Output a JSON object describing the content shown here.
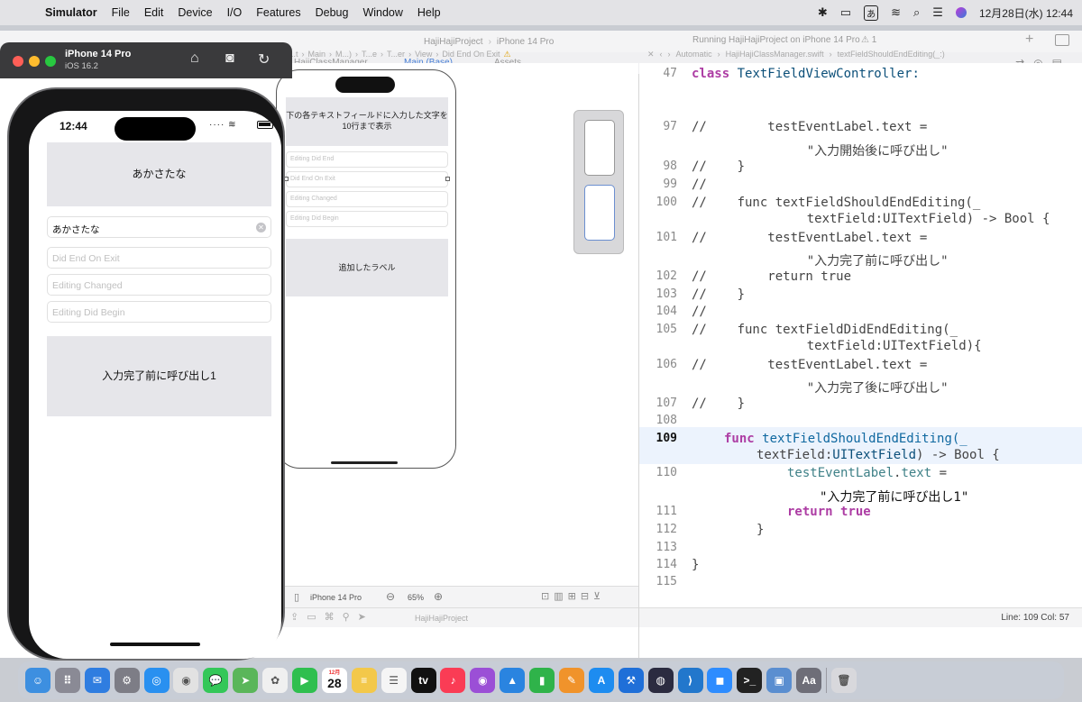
{
  "menubar": {
    "app": "Simulator",
    "items": [
      "File",
      "Edit",
      "Device",
      "I/O",
      "Features",
      "Debug",
      "Window",
      "Help"
    ],
    "input_method": "あ",
    "clock": "12月28日(水) 12:44"
  },
  "xcode": {
    "project": "HajiHajiProject",
    "scheme_device": "iPhone 14 Pro",
    "status": "Running HajiHajiProject on iPhone 14 Pro",
    "warnings": "1",
    "tabs": [
      "HajiClassManager",
      "Main (Base)",
      "Assets"
    ],
    "left_jumpbar": [
      "H...t",
      "Main",
      "M...)",
      "T...e",
      "T...er",
      "View",
      "Did End On Exit"
    ],
    "right_jumpbar": [
      "Automatic",
      "HajiHajiClassManager.swift",
      "textFieldShouldEndEditing(_:)"
    ],
    "ib": {
      "header_text": "下の各テキストフィールドに入力した文字を10行まで表示",
      "fields": [
        "Editing Did End",
        "Did End On Exit",
        "Editing Changed",
        "Editing Did Begin"
      ],
      "added_label": "追加したラベル",
      "device": "iPhone 14 Pro",
      "zoom": "65%"
    },
    "code": {
      "lines": [
        {
          "n": "47",
          "t": "class TextFieldViewController:"
        },
        {
          "n": "97",
          "t": "//        testEventLabel.text ="
        },
        {
          "n": "",
          "t": "    \"入力開始後に呼び出し\""
        },
        {
          "n": "98",
          "t": "//    }"
        },
        {
          "n": "99",
          "t": "//"
        },
        {
          "n": "100",
          "t": "//    func textFieldShouldEndEditing(_"
        },
        {
          "n": "",
          "t": "    textField:UITextField) -> Bool {"
        },
        {
          "n": "101",
          "t": "//        testEventLabel.text ="
        },
        {
          "n": "",
          "t": "    \"入力完了前に呼び出し\""
        },
        {
          "n": "102",
          "t": "//        return true"
        },
        {
          "n": "103",
          "t": "//    }"
        },
        {
          "n": "104",
          "t": "//"
        },
        {
          "n": "105",
          "t": "//    func textFieldDidEndEditing(_"
        },
        {
          "n": "",
          "t": "    textField:UITextField){"
        },
        {
          "n": "106",
          "t": "//        testEventLabel.text ="
        },
        {
          "n": "",
          "t": "    \"入力完了後に呼び出し\""
        },
        {
          "n": "107",
          "t": "//    }"
        },
        {
          "n": "108",
          "t": ""
        },
        {
          "n": "109",
          "t": "func textFieldShouldEndEditing(_"
        },
        {
          "n": "",
          "t": "textField:UITextField) -> Bool {"
        },
        {
          "n": "110",
          "t": "testEventLabel.text ="
        },
        {
          "n": "",
          "t": "\"入力完了前に呼び出し1\""
        },
        {
          "n": "111",
          "t": "return true"
        },
        {
          "n": "112",
          "t": "}"
        },
        {
          "n": "113",
          "t": ""
        },
        {
          "n": "114",
          "t": "}"
        },
        {
          "n": "115",
          "t": ""
        }
      ],
      "cursor_pos": "Line: 109  Col: 57"
    }
  },
  "simulator": {
    "device": "iPhone 14 Pro",
    "ios": "iOS 16.2",
    "time": "12:44",
    "label_top": "あかさたな",
    "field_value": "あかさたな",
    "placeholders": [
      "Did End On Exit",
      "Editing Changed",
      "Editing Did Begin"
    ],
    "label_bottom": "入力完了前に呼び出し1"
  },
  "dock": {
    "apps": [
      "finder",
      "launchpad",
      "mail",
      "system-settings",
      "safari",
      "chrome",
      "messages",
      "maps",
      "photos",
      "facetime",
      "calendar",
      "notes",
      "reminders",
      "apple-tv",
      "music",
      "podcasts",
      "keynote",
      "numbers",
      "pages",
      "app-store",
      "xcode",
      "instruments",
      "vscode",
      "zoom",
      "terminal",
      "preview",
      "dictionary",
      "trash"
    ],
    "calendar_month": "12月",
    "calendar_day": "28",
    "accent": "#0a84ff"
  }
}
